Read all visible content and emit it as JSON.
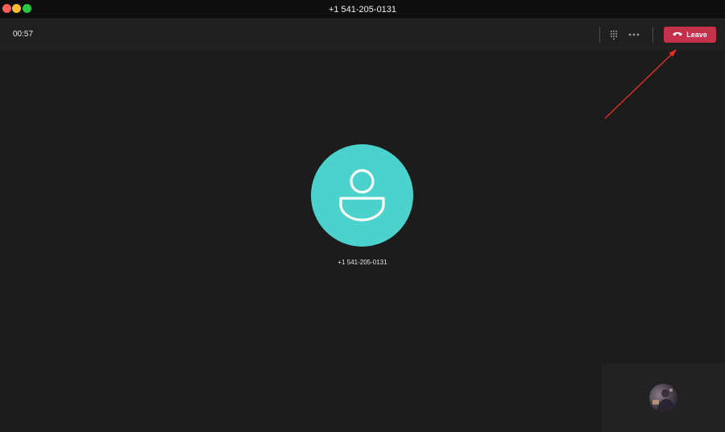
{
  "window": {
    "title": "+1 541-205-0131"
  },
  "toolbar": {
    "timer": "00:57",
    "leave_label": "Leave"
  },
  "call": {
    "caller_name": "+1 541-205-0131"
  },
  "colors": {
    "leave_button": "#c4314b",
    "avatar": "#4cd2cc",
    "annotation_arrow": "#e8321e"
  },
  "icons": {
    "dialpad": "dialpad-icon",
    "more": "more-options-icon",
    "hangup": "hang-up-icon",
    "person": "person-icon"
  }
}
